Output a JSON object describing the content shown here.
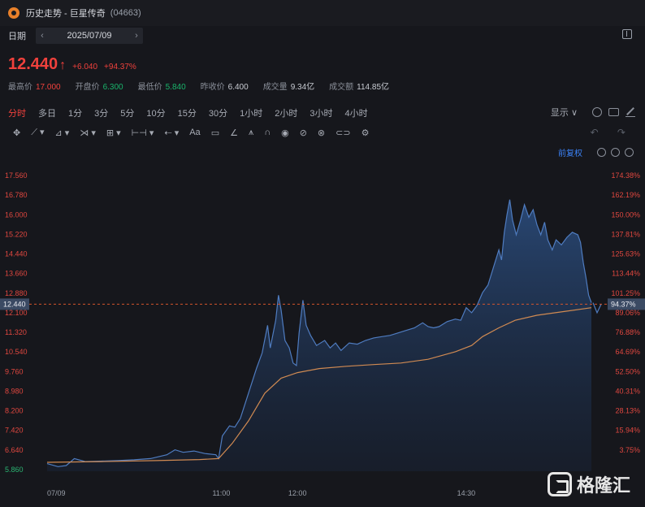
{
  "window": {
    "title": "历史走势 - 巨星传奇",
    "code": "(04663)"
  },
  "datebar": {
    "label": "日期",
    "prev": "‹",
    "date": "2025/07/09",
    "next": "›"
  },
  "quote": {
    "price": "12.440",
    "arrow": "↑",
    "change": "+6.040",
    "change_pct": "+94.37%"
  },
  "stats": [
    {
      "key": "最高价",
      "value": "17.000",
      "tone": "red"
    },
    {
      "key": "开盘价",
      "value": "6.300",
      "tone": "green"
    },
    {
      "key": "最低价",
      "value": "5.840",
      "tone": "green"
    },
    {
      "key": "昨收价",
      "value": "6.400",
      "tone": ""
    },
    {
      "key": "成交量",
      "value": "9.34亿",
      "tone": ""
    },
    {
      "key": "成交额",
      "value": "114.85亿",
      "tone": ""
    }
  ],
  "tabs": [
    "分时",
    "多日",
    "1分",
    "3分",
    "5分",
    "10分",
    "15分",
    "30分",
    "1小时",
    "2小时",
    "3小时",
    "4小时"
  ],
  "active_tab": "分时",
  "right_tools": {
    "display_label": "显示",
    "chevron": "∨"
  },
  "drawing_tools": [
    "✥",
    "⟋ ▾",
    "⊿ ▾",
    "⋊ ▾",
    "⊞ ▾",
    "⊢⊣ ▾",
    "⇠ ▾",
    "Aa",
    "▭",
    "∠",
    "⩚",
    "∩",
    "◉",
    "⊘",
    "⊗",
    "⊂⊃",
    "⚙"
  ],
  "undo_redo": "↶ ↷",
  "chart_head": {
    "adjust_label": "前复权"
  },
  "watermark": {
    "text": "格隆汇"
  },
  "colors": {
    "up": "#f0413c",
    "down": "#19b46b",
    "price_line": "#4f7cc0",
    "avg_line": "#d08a52",
    "ref_line": "#d4552b"
  },
  "chart_data": {
    "type": "area",
    "x_tick_labels": [
      "07/09",
      "11:00",
      "12:00",
      "14:30"
    ],
    "x_tick_fraction": [
      0.0,
      0.32,
      0.46,
      0.77
    ],
    "y_left_ticks": [
      "17.560",
      "16.780",
      "16.000",
      "15.220",
      "14.440",
      "13.660",
      "12.880",
      "12.100",
      "11.320",
      "10.540",
      "9.760",
      "8.980",
      "8.200",
      "7.420",
      "6.640",
      "5.860"
    ],
    "y_right_ticks": [
      "174.38%",
      "162.19%",
      "150.00%",
      "137.81%",
      "125.63%",
      "113.44%",
      "101.25%",
      "89.06%",
      "76.88%",
      "64.69%",
      "52.50%",
      "40.31%",
      "28.13%",
      "15.94%",
      "3.75%",
      ""
    ],
    "ylim": [
      5.86,
      17.56
    ],
    "current_price": 12.44,
    "current_pct": "94.37%",
    "price": [
      [
        0.0,
        6.1
      ],
      [
        0.02,
        5.98
      ],
      [
        0.035,
        6.02
      ],
      [
        0.05,
        6.3
      ],
      [
        0.07,
        6.18
      ],
      [
        0.1,
        6.2
      ],
      [
        0.13,
        6.22
      ],
      [
        0.16,
        6.25
      ],
      [
        0.19,
        6.3
      ],
      [
        0.22,
        6.45
      ],
      [
        0.235,
        6.65
      ],
      [
        0.25,
        6.55
      ],
      [
        0.27,
        6.6
      ],
      [
        0.29,
        6.5
      ],
      [
        0.31,
        6.45
      ],
      [
        0.315,
        6.3
      ],
      [
        0.322,
        7.2
      ],
      [
        0.335,
        7.6
      ],
      [
        0.345,
        7.55
      ],
      [
        0.355,
        7.9
      ],
      [
        0.37,
        8.9
      ],
      [
        0.385,
        9.9
      ],
      [
        0.395,
        10.5
      ],
      [
        0.405,
        11.6
      ],
      [
        0.41,
        10.7
      ],
      [
        0.42,
        11.8
      ],
      [
        0.425,
        12.8
      ],
      [
        0.43,
        12.2
      ],
      [
        0.437,
        11.0
      ],
      [
        0.445,
        10.7
      ],
      [
        0.452,
        10.1
      ],
      [
        0.458,
        10.0
      ],
      [
        0.463,
        11.3
      ],
      [
        0.47,
        12.6
      ],
      [
        0.476,
        11.6
      ],
      [
        0.484,
        11.2
      ],
      [
        0.495,
        10.8
      ],
      [
        0.51,
        11.0
      ],
      [
        0.52,
        10.7
      ],
      [
        0.53,
        10.9
      ],
      [
        0.54,
        10.6
      ],
      [
        0.555,
        10.9
      ],
      [
        0.57,
        10.85
      ],
      [
        0.585,
        11.0
      ],
      [
        0.6,
        11.1
      ],
      [
        0.615,
        11.15
      ],
      [
        0.63,
        11.2
      ],
      [
        0.645,
        11.3
      ],
      [
        0.66,
        11.4
      ],
      [
        0.675,
        11.5
      ],
      [
        0.69,
        11.7
      ],
      [
        0.7,
        11.55
      ],
      [
        0.71,
        11.5
      ],
      [
        0.72,
        11.55
      ],
      [
        0.735,
        11.75
      ],
      [
        0.75,
        11.85
      ],
      [
        0.76,
        11.8
      ],
      [
        0.77,
        12.3
      ],
      [
        0.78,
        12.1
      ],
      [
        0.79,
        12.4
      ],
      [
        0.8,
        12.9
      ],
      [
        0.81,
        13.2
      ],
      [
        0.82,
        13.9
      ],
      [
        0.83,
        14.6
      ],
      [
        0.835,
        14.2
      ],
      [
        0.84,
        15.3
      ],
      [
        0.845,
        16.0
      ],
      [
        0.85,
        16.6
      ],
      [
        0.855,
        15.8
      ],
      [
        0.862,
        15.2
      ],
      [
        0.87,
        15.8
      ],
      [
        0.877,
        16.4
      ],
      [
        0.885,
        15.9
      ],
      [
        0.893,
        16.2
      ],
      [
        0.9,
        15.6
      ],
      [
        0.907,
        15.2
      ],
      [
        0.914,
        15.7
      ],
      [
        0.92,
        15.0
      ],
      [
        0.928,
        14.6
      ],
      [
        0.935,
        15.0
      ],
      [
        0.945,
        14.8
      ],
      [
        0.955,
        15.1
      ],
      [
        0.965,
        15.3
      ],
      [
        0.975,
        15.2
      ],
      [
        0.98,
        14.9
      ],
      [
        0.985,
        14.1
      ],
      [
        0.99,
        13.5
      ],
      [
        0.995,
        12.8
      ],
      [
        1.0,
        12.5
      ]
    ],
    "tail": [
      [
        1.0,
        12.5
      ],
      [
        1.005,
        12.1
      ],
      [
        1.01,
        12.44
      ]
    ],
    "avg": [
      [
        0.0,
        6.15
      ],
      [
        0.1,
        6.18
      ],
      [
        0.2,
        6.22
      ],
      [
        0.28,
        6.26
      ],
      [
        0.315,
        6.3
      ],
      [
        0.34,
        6.9
      ],
      [
        0.37,
        7.8
      ],
      [
        0.4,
        8.9
      ],
      [
        0.43,
        9.5
      ],
      [
        0.46,
        9.72
      ],
      [
        0.5,
        9.88
      ],
      [
        0.55,
        9.97
      ],
      [
        0.6,
        10.04
      ],
      [
        0.65,
        10.1
      ],
      [
        0.7,
        10.25
      ],
      [
        0.75,
        10.55
      ],
      [
        0.78,
        10.8
      ],
      [
        0.8,
        11.15
      ],
      [
        0.83,
        11.5
      ],
      [
        0.86,
        11.8
      ],
      [
        0.9,
        12.0
      ],
      [
        0.95,
        12.15
      ],
      [
        1.0,
        12.3
      ]
    ]
  }
}
